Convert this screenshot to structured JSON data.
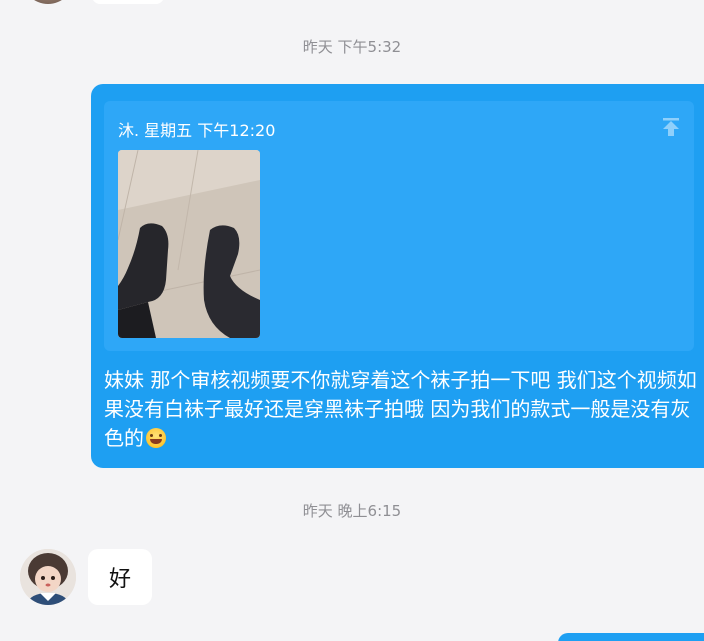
{
  "timestamps": {
    "first": "昨天 下午5:32",
    "second": "昨天 晚上6:15"
  },
  "forwarded_message": {
    "quote_header": "沐. 星期五 下午12:20",
    "pin_icon": "upload-arrow-icon",
    "photo_description_icon": "photo",
    "text": "妹妹 那个审核视频要不你就穿着这个袜子拍一下吧 我们这个视频如果没有白袜子最好还是穿黑袜子拍哦 因为我们的款式一般是没有灰色的",
    "emoji": "laughing-tears-emoji",
    "bubble_color": "#1e9ff2"
  },
  "reply_message": {
    "text": "好"
  }
}
